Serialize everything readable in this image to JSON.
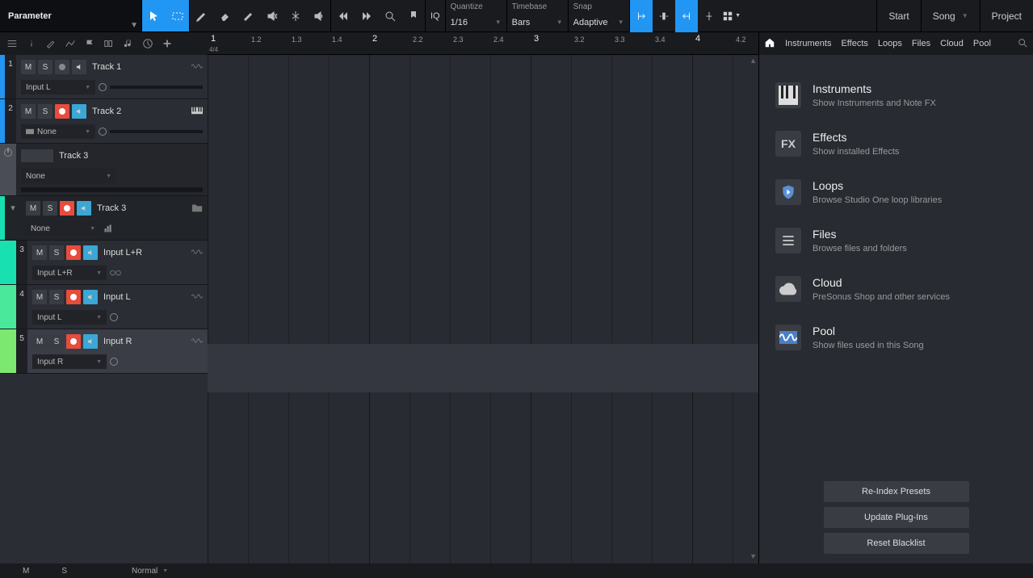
{
  "header": {
    "parameter_label": "Parameter",
    "quantize": {
      "label": "Quantize",
      "value": "1/16"
    },
    "timebase": {
      "label": "Timebase",
      "value": "Bars"
    },
    "snap": {
      "label": "Snap",
      "value": "Adaptive"
    },
    "nav": {
      "start": "Start",
      "song": "Song",
      "project": "Project"
    }
  },
  "ruler": {
    "sig": "4/4",
    "ticks": [
      {
        "pos": 0,
        "label": "1",
        "major": true
      },
      {
        "pos": 50,
        "label": "1.2"
      },
      {
        "pos": 100,
        "label": "1.3"
      },
      {
        "pos": 150,
        "label": "1.4"
      },
      {
        "pos": 200,
        "label": "2",
        "major": true
      },
      {
        "pos": 250,
        "label": "2.2"
      },
      {
        "pos": 300,
        "label": "2.3"
      },
      {
        "pos": 350,
        "label": "2.4"
      },
      {
        "pos": 400,
        "label": "3",
        "major": true
      },
      {
        "pos": 450,
        "label": "3.2"
      },
      {
        "pos": 500,
        "label": "3.3"
      },
      {
        "pos": 550,
        "label": "3.4"
      },
      {
        "pos": 600,
        "label": "4",
        "major": true
      },
      {
        "pos": 650,
        "label": "4.2"
      }
    ]
  },
  "tracks": [
    {
      "num": "1",
      "name": "Track 1",
      "color": "#2196f3",
      "armed": false,
      "mon": false,
      "input": "Input L",
      "type": "audio"
    },
    {
      "num": "2",
      "name": "Track 2",
      "color": "#2196f3",
      "armed": true,
      "mon": true,
      "input": "None",
      "type": "instrument",
      "input_icon": true
    }
  ],
  "folder": {
    "name": "Track 3",
    "parent_name": "Track 3",
    "color": "#18e0b0",
    "input": "None",
    "sub_input": "None"
  },
  "sub_tracks": [
    {
      "num": "3",
      "name": "Input L+R",
      "color": "#18e0b0",
      "armed": true,
      "mon": true,
      "input": "Input L+R",
      "link": true
    },
    {
      "num": "4",
      "name": "Input L",
      "color": "#4ae89a",
      "armed": true,
      "mon": true,
      "input": "Input L"
    },
    {
      "num": "5",
      "name": "Input R",
      "color": "#7de870",
      "armed": true,
      "mon": true,
      "input": "Input R",
      "selected": true
    }
  ],
  "browser": {
    "tabs": [
      "Instruments",
      "Effects",
      "Loops",
      "Files",
      "Cloud",
      "Pool"
    ],
    "items": [
      {
        "title": "Instruments",
        "desc": "Show Instruments and Note FX",
        "icon": "piano"
      },
      {
        "title": "Effects",
        "desc": "Show installed Effects",
        "icon": "FX"
      },
      {
        "title": "Loops",
        "desc": "Browse Studio One loop libraries",
        "icon": "shield"
      },
      {
        "title": "Files",
        "desc": "Browse files and folders",
        "icon": "list"
      },
      {
        "title": "Cloud",
        "desc": "PreSonus Shop and other services",
        "icon": "cloud"
      },
      {
        "title": "Pool",
        "desc": "Show files used in this Song",
        "icon": "wave"
      }
    ],
    "buttons": [
      "Re-Index Presets",
      "Update Plug-Ins",
      "Reset Blacklist"
    ]
  },
  "status": {
    "m": "M",
    "s": "S",
    "mode": "Normal"
  }
}
